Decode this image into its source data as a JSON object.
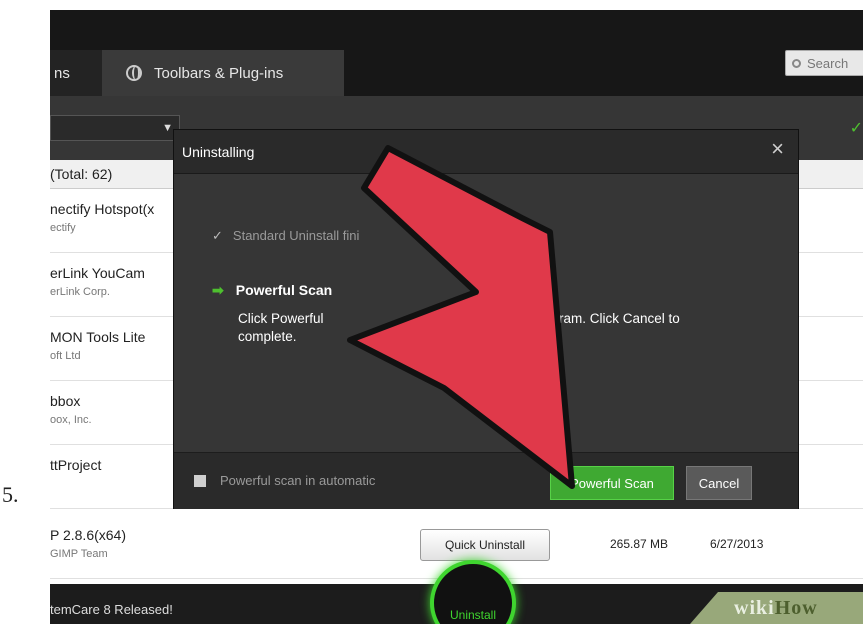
{
  "step_number": "5.",
  "tabs": [
    "ns",
    "Toolbars & Plug-ins"
  ],
  "search": {
    "placeholder": "Search"
  },
  "list": {
    "header": "(Total: 62)",
    "rows": [
      {
        "name": "nectify Hotspot(x",
        "publisher": "ectify"
      },
      {
        "name": "erLink YouCam",
        "publisher": "erLink Corp."
      },
      {
        "name": "MON Tools Lite",
        "publisher": "oft Ltd"
      },
      {
        "name": "bbox",
        "publisher": "oox, Inc."
      },
      {
        "name": "ttProject",
        "publisher": ""
      },
      {
        "name": "P 2.8.6(x64)",
        "publisher": "GIMP Team",
        "action": "Quick Uninstall",
        "size": "265.87 MB",
        "date": "6/27/2013"
      }
    ]
  },
  "bottom": {
    "news": "temCare 8 Released!",
    "big_button": "Uninstall",
    "watermark_wiki": "wiki",
    "watermark_how": "How"
  },
  "dialog": {
    "title": "Uninstalling",
    "close_glyph": "×",
    "step1": "Standard Uninstall fini",
    "step2": "Powerful Scan",
    "desc_line1_left": "Click Powerful",
    "desc_line1_right": "program. Click Cancel to",
    "desc_line2": "complete.",
    "checkbox_label": "Powerful scan in automatic",
    "powerful_scan_button": "Powerful Scan",
    "cancel_button": "Cancel"
  },
  "icons": {
    "globe": "globe-icon",
    "search": "search-icon",
    "check": "check-icon",
    "arrow": "arrow-right-icon",
    "pointer": "red-arrow-pointer-icon"
  },
  "colors": {
    "accent_green": "#3fa932",
    "arrow_red": "#e0394a"
  }
}
